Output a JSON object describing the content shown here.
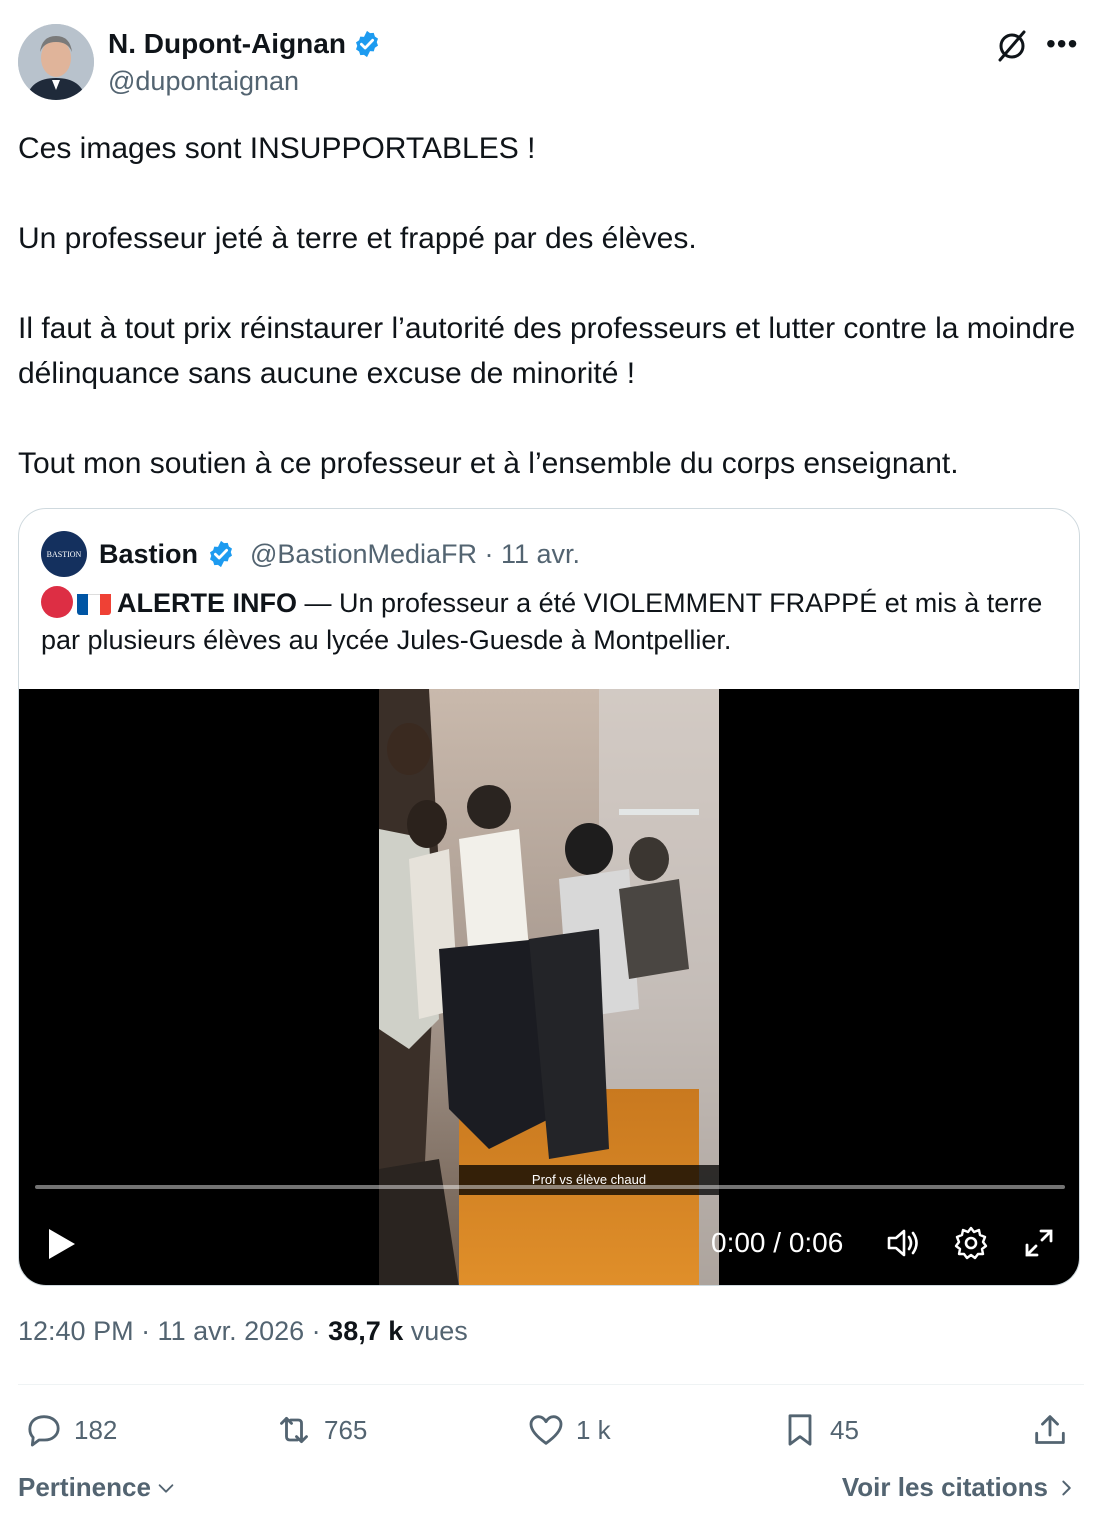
{
  "author": {
    "name": "N. Dupont-Aignan",
    "handle": "@dupontaignan",
    "verified": true
  },
  "tweet_paragraphs": [
    "Ces images sont INSUPPORTABLES !",
    "",
    "Un professeur jeté à terre et frappé par des élèves.",
    "",
    "Il faut à tout prix réinstaurer l’autorité des professeurs et lutter contre la moindre délinquance sans aucune excuse de minorité !",
    "",
    "Tout mon soutien à ce professeur et à l’ensemble du corps enseignant."
  ],
  "quote": {
    "avatar_text": "BASTION",
    "name": "Bastion",
    "handle": "@BastionMediaFR · 11 avr.",
    "alert_label": "ALERTE INFO",
    "text": " — Un professeur a été VIOLEMMENT FRAPPÉ et mis à terre par plusieurs élèves au lycée Jules-Guesde à Montpellier.",
    "video": {
      "caption": "Prof vs élève chaud",
      "time": "0:00 / 0:06",
      "progress": 0
    }
  },
  "meta": {
    "time": "12:40 PM · 11 avr. 2026 · ",
    "views_count": "38,7 k",
    "views_label": " vues"
  },
  "actions": {
    "replies": "182",
    "retweets": "765",
    "likes": "1 k",
    "bookmarks": "45"
  },
  "footer": {
    "sort_label": "Pertinence",
    "quotes_link": "Voir les citations"
  },
  "colors": {
    "verified": "#1d9bf0",
    "secondary_text": "#536471",
    "alert_dot": "#dd2e44"
  }
}
